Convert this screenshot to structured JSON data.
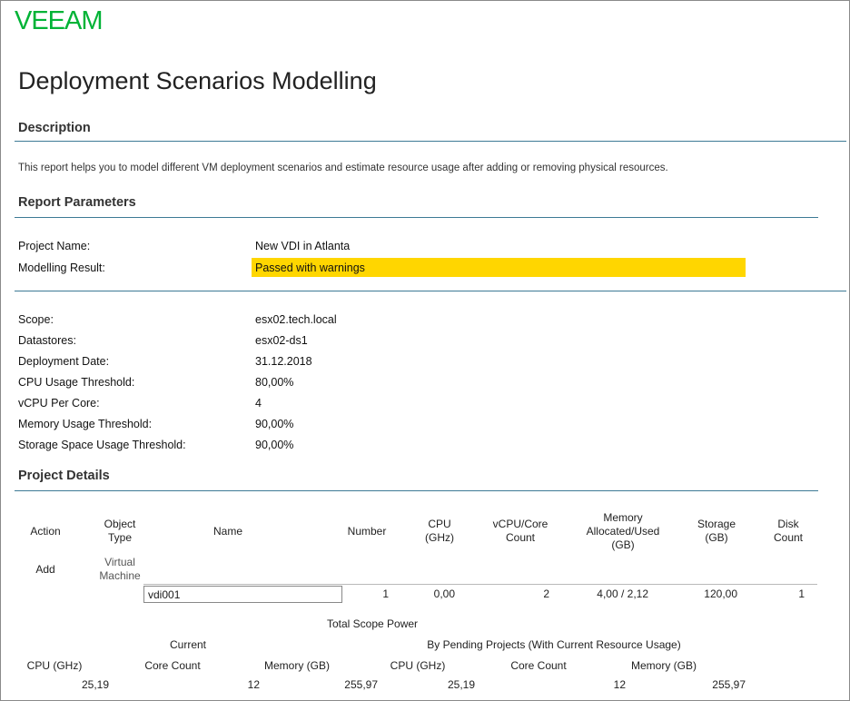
{
  "brand": {
    "logo_text": "VEEAM",
    "color": "#00b336"
  },
  "report_title": "Deployment Scenarios Modelling",
  "description": {
    "heading": "Description",
    "text": "This report helps you to model different VM deployment scenarios and estimate resource usage after adding or removing physical resources."
  },
  "parameters": {
    "heading": "Report Parameters",
    "project_name_label": "Project Name:",
    "project_name_value": "New VDI in Atlanta",
    "result_label": "Modelling Result:",
    "result_value": "Passed with warnings",
    "result_color": "#ffd600",
    "rows": [
      {
        "label": "Scope:",
        "value": "esx02.tech.local"
      },
      {
        "label": "Datastores:",
        "value": "esx02-ds1"
      },
      {
        "label": "Deployment Date:",
        "value": "31.12.2018"
      },
      {
        "label": "CPU Usage Threshold:",
        "value": "80,00%"
      },
      {
        "label": "vCPU Per Core:",
        "value": "4"
      },
      {
        "label": "Memory Usage Threshold:",
        "value": "90,00%"
      },
      {
        "label": "Storage Space Usage Threshold:",
        "value": "90,00%"
      }
    ]
  },
  "project_details": {
    "heading": "Project Details",
    "columns": {
      "action": "Action",
      "object_type_1": "Object",
      "object_type_2": "Type",
      "name": "Name",
      "number": "Number",
      "cpu_1": "CPU",
      "cpu_2": "(GHz)",
      "vcpu_1": "vCPU/Core",
      "vcpu_2": "Count",
      "mem_1": "Memory",
      "mem_2": "Allocated/Used",
      "mem_3": "(GB)",
      "storage_1": "Storage",
      "storage_2": "(GB)",
      "disk_1": "Disk",
      "disk_2": "Count"
    },
    "group": {
      "action": "Add",
      "type_1": "Virtual",
      "type_2": "Machine"
    },
    "row": {
      "name": "vdi001",
      "number": "1",
      "cpu": "0,00",
      "vcpu": "2",
      "memory": "4,00 / 2,12",
      "storage": "120,00",
      "disk": "1"
    }
  },
  "scope_power": {
    "title": "Total Scope Power",
    "current_label": "Current",
    "pending_label": "By Pending Projects (With Current Resource Usage)",
    "headers": {
      "cpu": "CPU (GHz)",
      "cores": "Core Count",
      "memory": "Memory (GB)"
    },
    "current": {
      "cpu": "25,19",
      "cores": "12",
      "memory": "255,97"
    },
    "pending": {
      "cpu": "25,19",
      "cores": "12",
      "memory": "255,97"
    }
  }
}
